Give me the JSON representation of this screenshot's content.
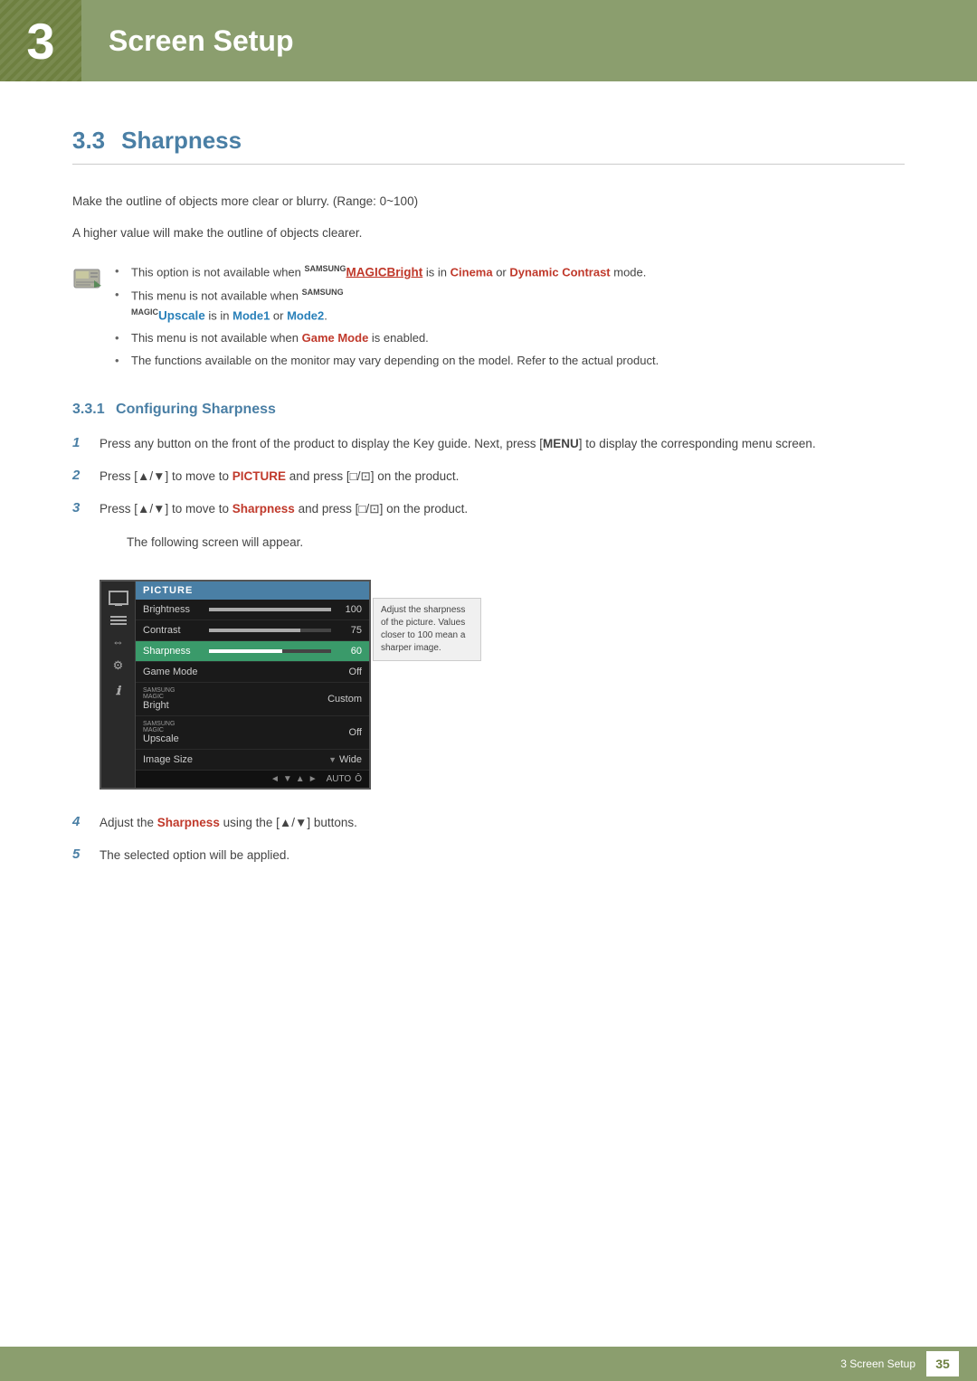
{
  "header": {
    "chapter_number": "3",
    "chapter_title": "Screen Setup"
  },
  "section": {
    "number": "3.3",
    "title": "Sharpness",
    "description1": "Make the outline of objects more clear or blurry. (Range: 0~100)",
    "description2": "A higher value will make the outline of objects clearer."
  },
  "notes": [
    "This option is not available when SAMSUNGBright is in Cinema or Dynamic Contrast mode.",
    "This menu is not available when SAMSUNGUpscale is in Mode1 or Mode2.",
    "This menu is not available when Game Mode is enabled.",
    "The functions available on the monitor may vary depending on the model. Refer to the actual product."
  ],
  "subsection": {
    "number": "3.3.1",
    "title": "Configuring Sharpness"
  },
  "steps": [
    {
      "num": "1",
      "text": "Press any button on the front of the product to display the Key guide. Next, press [MENU] to display the corresponding menu screen."
    },
    {
      "num": "2",
      "text": "Press [▲/▼] to move to PICTURE and press [□/□] on the product."
    },
    {
      "num": "3",
      "text": "Press [▲/▼] to move to Sharpness and press [□/□] on the product."
    },
    {
      "num": "3_sub",
      "text": "The following screen will appear."
    },
    {
      "num": "4",
      "text": "Adjust the Sharpness using the [▲/▼] buttons."
    },
    {
      "num": "5",
      "text": "The selected option will be applied."
    }
  ],
  "monitor_menu": {
    "header": "PICTURE",
    "rows": [
      {
        "label": "Brightness",
        "bar": 100,
        "value": "100",
        "active": false
      },
      {
        "label": "Contrast",
        "bar": 75,
        "value": "75",
        "active": false
      },
      {
        "label": "Sharpness",
        "bar": 60,
        "value": "60",
        "active": true
      },
      {
        "label": "Game Mode",
        "bar": -1,
        "value": "Off",
        "active": false
      },
      {
        "label": "MAGICBright",
        "bar": -1,
        "value": "Custom",
        "active": false,
        "samsung": true
      },
      {
        "label": "MAGICUpscale",
        "bar": -1,
        "value": "Off",
        "active": false,
        "samsung": true
      },
      {
        "label": "Image Size",
        "bar": -1,
        "value": "Wide",
        "active": false
      }
    ]
  },
  "tooltip": "Adjust the sharpness of the picture. Values closer to 100 mean a sharper image.",
  "footer": {
    "text": "3 Screen Setup",
    "page": "35"
  }
}
